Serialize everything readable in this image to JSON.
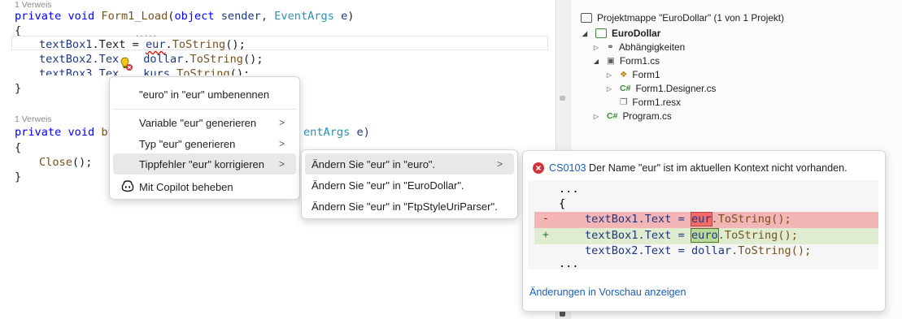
{
  "editor": {
    "refs": {
      "top": "1 Verweis",
      "second": "1 Verweis"
    },
    "load_signature": {
      "kw1": "private",
      "kw2": "void",
      "name": " Form1_Load",
      "open": "(",
      "ptype1": "object",
      "pname1": " sender, ",
      "ptype2": "EventArgs",
      "pname2": " e",
      "close": ")"
    },
    "brace_open": "{",
    "brace_close": "}",
    "line1": {
      "a": "textBox1",
      "b": ".Text = ",
      "c": "eur",
      "d": ".",
      "e": "ToString",
      "f": "();"
    },
    "line2": {
      "a": "textBox2.Tex",
      "b": "dollar",
      "c": ".",
      "d": "ToString",
      "e": "();"
    },
    "line3": {
      "a": "textBox3.Tex",
      "b": "kurs",
      "c": ".",
      "d": "ToString",
      "e": "();"
    },
    "btn_signature": {
      "kw1": "private",
      "kw2": "void",
      "name": " bu",
      "rest_type": "entArgs",
      "rest_name": " e)"
    },
    "close_call": {
      "a": "Close",
      "b": "();"
    },
    "dots": "....."
  },
  "context_menu": {
    "items": [
      {
        "label": "\"euro\" in \"eur\" umbenennen"
      },
      {
        "label": "Variable \"eur\" generieren",
        "arrow": ">"
      },
      {
        "label": "Typ \"eur\" generieren",
        "arrow": ">"
      },
      {
        "label": "Tippfehler \"eur\" korrigieren",
        "arrow": ">"
      },
      {
        "label": "Mit Copilot beheben"
      }
    ]
  },
  "submenu": {
    "items": [
      {
        "label": "Ändern Sie \"eur\" in \"euro\".",
        "arrow": ">"
      },
      {
        "label": "Ändern Sie \"eur\" in \"EuroDollar\"."
      },
      {
        "label": "Ändern Sie \"eur\" in \"FtpStyleUriParser\"."
      }
    ]
  },
  "preview": {
    "error_code": "CS0103",
    "error_text": " Der Name \"eur\" ist im aktuellen Kontext nicht vorhanden.",
    "ellipsis": "...",
    "brace": "{",
    "removed": {
      "sign": "-",
      "a": "textBox1.Text = ",
      "b": "eur",
      "c": ".ToString();"
    },
    "added": {
      "sign": "+",
      "a": "textBox1.Text = ",
      "b": "euro",
      "c": ".ToString();"
    },
    "context": {
      "a": "textBox2.Text = ",
      "b": "dollar",
      "c": ".ToString();"
    },
    "link": "Änderungen in Vorschau anzeigen"
  },
  "solution": {
    "header": "Projektmappe \"EuroDollar\" (1 von 1 Projekt)",
    "project": "EuroDollar",
    "items": [
      {
        "label": "Abhängigkeiten",
        "icon": "dependencies-icon",
        "glyph": "⚭"
      },
      {
        "label": "Form1.cs",
        "icon": "form-icon",
        "glyph": "▣"
      },
      {
        "label": "Form1",
        "icon": "class-icon",
        "glyph": "❖"
      },
      {
        "label": "Form1.Designer.cs",
        "icon": "csharp-file-icon",
        "glyph": "C#"
      },
      {
        "label": "Form1.resx",
        "icon": "resource-file-icon",
        "glyph": "❐"
      },
      {
        "label": "Program.cs",
        "icon": "csharp-file-icon",
        "glyph": "C#"
      }
    ],
    "expanded_glyph": "◢",
    "collapsed_glyph": "▷"
  },
  "colors": {
    "keyword": "#0000ff",
    "type": "#2b91af",
    "method": "#74531f",
    "variable": "#1f377f",
    "link": "#1a5fb4",
    "error": "#d13438"
  }
}
